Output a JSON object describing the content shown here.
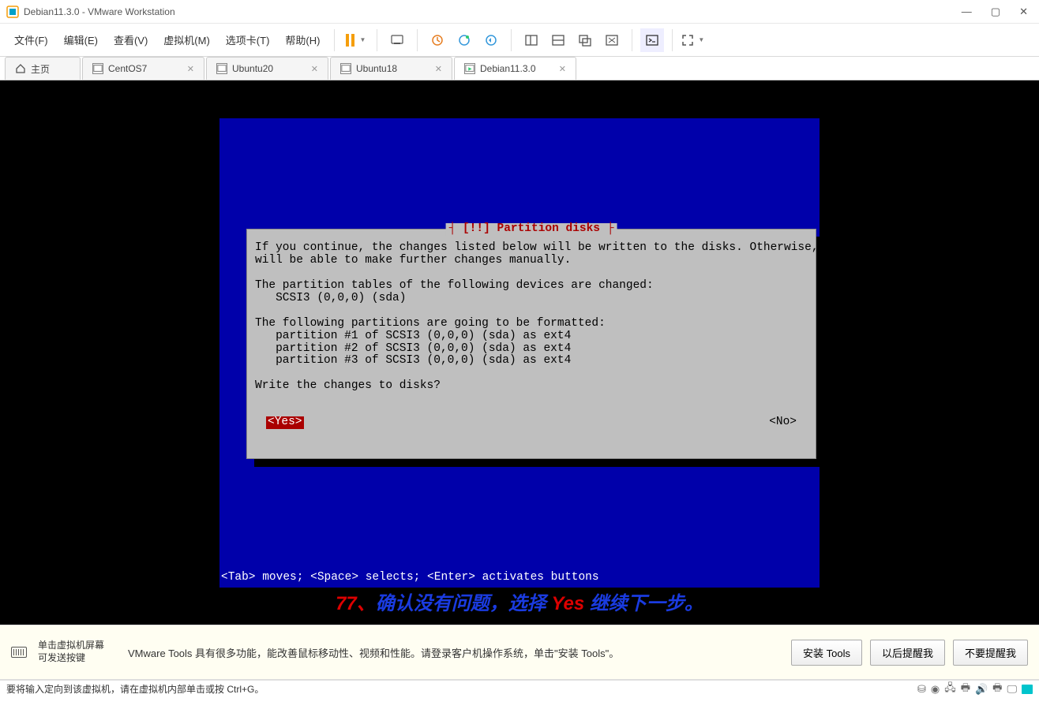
{
  "window": {
    "title": "Debian11.3.0 - VMware Workstation"
  },
  "menu": {
    "file": "文件(F)",
    "edit": "编辑(E)",
    "view": "查看(V)",
    "vm": "虚拟机(M)",
    "tabs": "选项卡(T)",
    "help": "帮助(H)"
  },
  "tabs": {
    "home": "主页",
    "t1": "CentOS7",
    "t2": "Ubuntu20",
    "t3": "Ubuntu18",
    "t4": "Debian11.3.0"
  },
  "installer": {
    "title_bracket_l": "┤ ",
    "title_text": "[!!] Partition disks",
    "title_bracket_r": " ├",
    "body_l1": "If you continue, the changes listed below will be written to the disks. Otherwise, you",
    "body_l2": "will be able to make further changes manually.",
    "body_l3": "",
    "body_l4": "The partition tables of the following devices are changed:",
    "body_l5": "   SCSI3 (0,0,0) (sda)",
    "body_l6": "",
    "body_l7": "The following partitions are going to be formatted:",
    "body_l8": "   partition #1 of SCSI3 (0,0,0) (sda) as ext4",
    "body_l9": "   partition #2 of SCSI3 (0,0,0) (sda) as ext4",
    "body_l10": "   partition #3 of SCSI3 (0,0,0) (sda) as ext4",
    "body_l11": "",
    "body_l12": "Write the changes to disks?",
    "yes": "<Yes>",
    "no": "<No>",
    "hint": "<Tab> moves; <Space> selects; <Enter> activates buttons"
  },
  "caption": {
    "num": "77、",
    "text_a": "确认没有问题，选择 ",
    "yes": "Yes ",
    "text_b": "继续下一步。"
  },
  "toolsbar": {
    "kb_l1": "单击虚拟机屏幕",
    "kb_l2": "可发送按键",
    "msg": "VMware Tools 具有很多功能，能改善鼠标移动性、视频和性能。请登录客户机操作系统，单击\"安装 Tools\"。",
    "b1": "安装 Tools",
    "b2": "以后提醒我",
    "b3": "不要提醒我"
  },
  "status": {
    "msg": "要将输入定向到该虚拟机，请在虚拟机内部单击或按 Ctrl+G。"
  }
}
